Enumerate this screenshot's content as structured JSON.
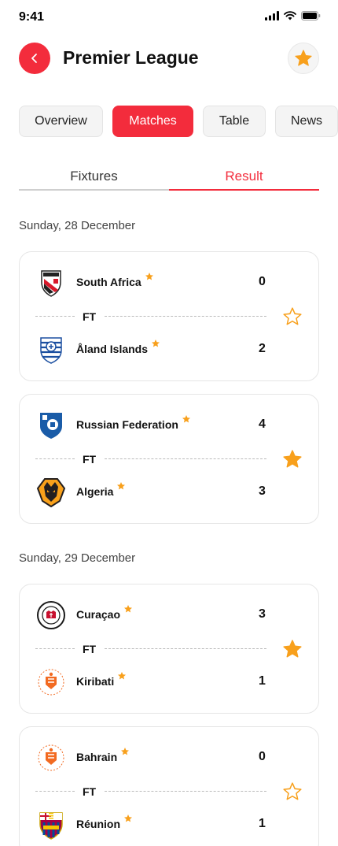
{
  "status": {
    "time": "9:41"
  },
  "header": {
    "title": "Premier League",
    "back_icon": "chevron-left-icon",
    "favorite_icon": "star-icon"
  },
  "tabs": [
    {
      "label": "Overview",
      "active": false
    },
    {
      "label": "Matches",
      "active": true
    },
    {
      "label": "Table",
      "active": false
    },
    {
      "label": "News",
      "active": false
    }
  ],
  "subtabs": [
    {
      "label": "Fixtures",
      "active": false
    },
    {
      "label": "Result",
      "active": true
    }
  ],
  "groups": [
    {
      "date": "Sunday, 28 December",
      "matches": [
        {
          "status": "FT",
          "favorite": false,
          "home": {
            "name": "South Africa",
            "score": "0",
            "logo": "ingolstadt-crest"
          },
          "away": {
            "name": "Åland Islands",
            "score": "2",
            "logo": "qpr-crest"
          }
        },
        {
          "status": "FT",
          "favorite": true,
          "home": {
            "name": "Russian Federation",
            "score": "4",
            "logo": "hoffenheim-crest"
          },
          "away": {
            "name": "Algeria",
            "score": "3",
            "logo": "wolves-crest"
          }
        }
      ]
    },
    {
      "date": "Sunday, 29 December",
      "matches": [
        {
          "status": "FT",
          "favorite": true,
          "home": {
            "name": "Curaçao",
            "score": "3",
            "logo": "st-pauli-crest"
          },
          "away": {
            "name": "Kiribati",
            "score": "1",
            "logo": "blackpool-crest"
          }
        },
        {
          "status": "FT",
          "favorite": false,
          "home": {
            "name": "Bahrain",
            "score": "0",
            "logo": "blackpool-crest"
          },
          "away": {
            "name": "Réunion",
            "score": "1",
            "logo": "barcelona-crest"
          }
        }
      ]
    }
  ],
  "colors": {
    "accent": "#f32c3c",
    "star": "#f8a01c",
    "card_border": "#e6e6e6"
  }
}
